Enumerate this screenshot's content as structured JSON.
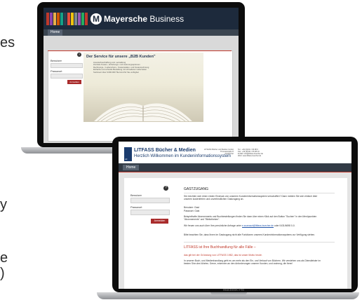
{
  "cropped_edge_text": {
    "left_top": "es",
    "left_mid": "y",
    "left_low": "e",
    "left_bottom": ")"
  },
  "laptop1": {
    "brand_bar_colors": [
      "#c0392b",
      "#8e44ad",
      "#e8b04a",
      "#d35400",
      "#16a085",
      "#2c3e50",
      "#e74c3c",
      "#f1c40f",
      "#7f8c8d",
      "#9b59b6",
      "#27ae60",
      "#c0392b"
    ],
    "logo_letter": "M",
    "title_bold": "Mayersche",
    "title_rest": " Business",
    "nav_home": "Home",
    "help": "?",
    "username_label": "Benutzer",
    "password_label": "Passwort",
    "login_button": "Anmelden",
    "promo_title": "Der Service für unsere „B2B Kunden\"",
    "promo_items": [
      "Literaturbeschaffung und -verwaltung",
      "Zentrale Kosten-, Erhebungs- und Lieferungsoptionen",
      "Rechnungs- / Lieferschein-, Kostenstellen- und Kostenrechnung",
      "Einfache und schnelle Bestellung mit schnelleren Lieferzeiten",
      "Sortiment über 9.600.000 Titel sind für Sie verfügbar"
    ]
  },
  "laptop2": {
    "logo": "LiF",
    "company_name": "LITFASS Bücher & Medien",
    "welcome": "Herzlich Willkommen im Kundeninformationssystem",
    "address": [
      "LITFASS Bücher und Medien GmbH",
      "Thomasstraße 8",
      "24103 Kiel"
    ],
    "contact": [
      "Tel.: +49 (0)431 / 66 98 0",
      "Fax: +49 (0)431 / 66 98 10",
      "E-Mail: info@litfass-buecher.de",
      "Web: www.litfass-buecher.de"
    ],
    "nav_home": "Home",
    "help": "?",
    "username_label": "Benutzer",
    "password_label": "Passwort",
    "login_button": "Anmelden",
    "content_heading": "GASTZUGANG",
    "para1": "Sie möchten sich einen ersten Eindruck von unserem Kundeninformationssystem verschaffen? Dann melden Sie sich einfach über unseren kostenfreien und unverbindlichen Gastzugang an.",
    "user_line": "Benutzer: Gast",
    "pass_line": "Passwort: Gast",
    "para2": "Beispielhafte Abonnements und Buchbestellungen finden Sie dann über einen Klick auf den Button \"Suchen\" in den Menüpunkten \"Abonnements\" und \"Bibliotheken\".",
    "para3_a": "Wir freuen uns auch über Ihre persönliche Anfrage unter ",
    "para3_link": "e.zuanazzi@litfass-buecher.de",
    "para3_b": " oder 0431/6698 0-0.",
    "para4": "Bitte beachten Sie, dass Ihnen im Gastzugang nicht alle Funktionen unseres Kundeninformationssystems zur Verfügung stehen.",
    "section_title": "LITFASS ist Ihre Buchhandlung für alle Fälle –",
    "section_sub": "das gilt bei der Gründung von LITFASS 1982, das ist unser Motto heute.",
    "para5": "In unserer Buch- und Medienhandlung geht es um mehr als den Ein- und Verkauf von Büchern. Wir verstehen uns als Dienstleister im besten Sinn des Wortes. Gerne, erkennen an den Anforderungen unserer Kunden, und zwinnng, die ihren!",
    "brand_footer": "MacBook Pro"
  }
}
